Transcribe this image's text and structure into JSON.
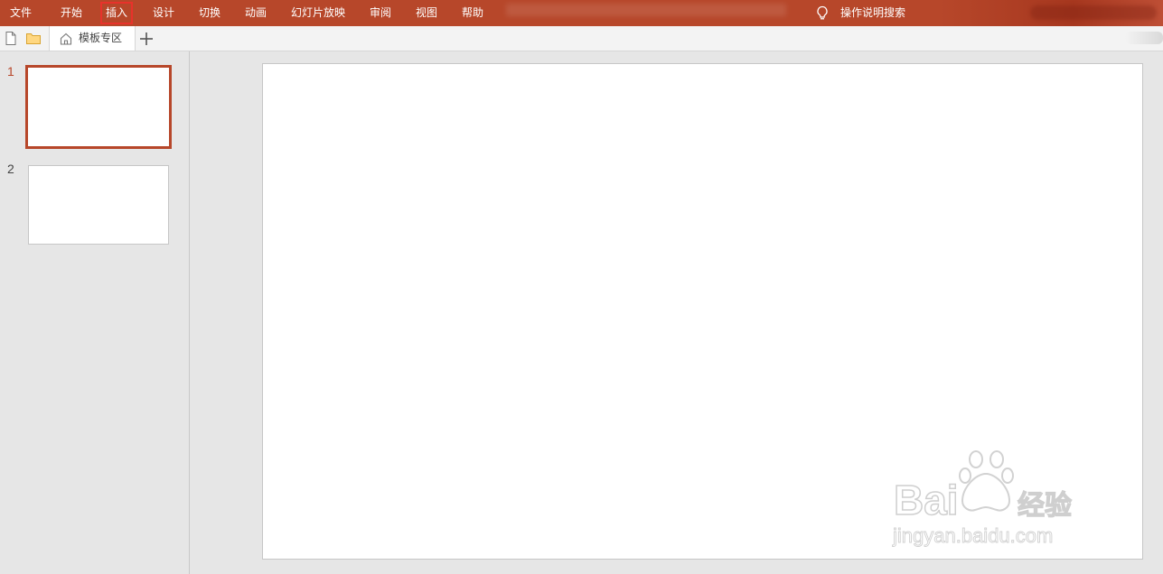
{
  "ribbon": {
    "tabs": [
      {
        "label": "文件"
      },
      {
        "label": "开始"
      },
      {
        "label": "插入",
        "active": true
      },
      {
        "label": "设计"
      },
      {
        "label": "切换"
      },
      {
        "label": "动画"
      },
      {
        "label": "幻灯片放映"
      },
      {
        "label": "审阅"
      },
      {
        "label": "视图"
      },
      {
        "label": "帮助"
      }
    ],
    "search_label": "操作说明搜索",
    "accent_color": "#b7472a",
    "highlight_color": "#e8322b"
  },
  "doc_bar": {
    "icons": [
      "new-document-icon",
      "open-folder-icon"
    ],
    "template_tab_label": "模板专区",
    "add_tab_icon": "plus-icon"
  },
  "slides": [
    {
      "number": "1",
      "selected": true
    },
    {
      "number": "2",
      "selected": false
    }
  ],
  "watermark": {
    "brand": "Bai du 经验",
    "url": "jingyan.baidu.com"
  }
}
